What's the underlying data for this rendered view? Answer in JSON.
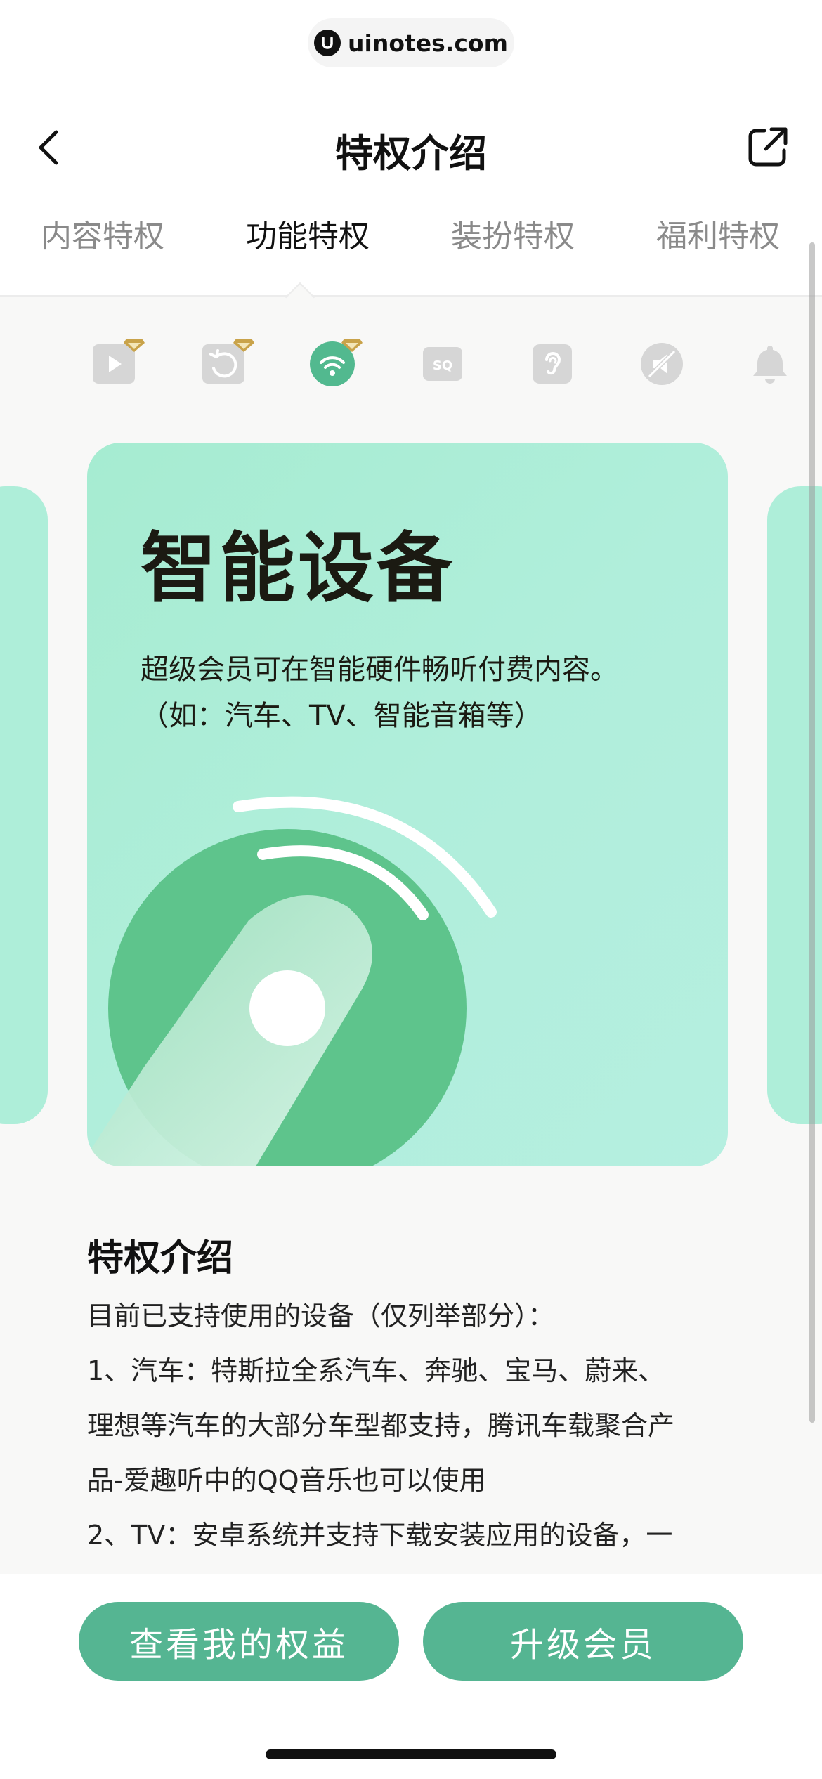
{
  "url_bar": {
    "domain": "uinotes.com"
  },
  "nav": {
    "title": "特权介绍"
  },
  "tabs": [
    {
      "label": "内容特权",
      "active": false
    },
    {
      "label": "功能特权",
      "active": true
    },
    {
      "label": "装扮特权",
      "active": false
    },
    {
      "label": "福利特权",
      "active": false
    }
  ],
  "privilege_icons": [
    {
      "name": "video-icon",
      "badge": true,
      "active": false
    },
    {
      "name": "replay-icon",
      "badge": true,
      "active": false
    },
    {
      "name": "smart-device-icon",
      "badge": true,
      "active": true
    },
    {
      "name": "sq-quality-icon",
      "badge": false,
      "active": false
    },
    {
      "name": "hearing-icon",
      "badge": false,
      "active": false
    },
    {
      "name": "no-ads-icon",
      "badge": false,
      "active": false
    },
    {
      "name": "bell-icon",
      "badge": false,
      "active": false
    }
  ],
  "card": {
    "title": "智能设备",
    "desc_line1": "超级会员可在智能硬件畅听付费内容。",
    "desc_line2": "（如：汽车、TV、智能音箱等）"
  },
  "section": {
    "title": "特权介绍",
    "line1": "目前已支持使用的设备（仅列举部分）：",
    "line2": "1、汽车：特斯拉全系汽车、奔驰、宝马、蔚来、",
    "line3": "理想等汽车的大部分车型都支持，腾讯车载聚合产",
    "line4": "品-爱趣听中的QQ音乐也可以使用",
    "line5": "2、TV：安卓系统并支持下载安装应用的设备，一"
  },
  "buttons": {
    "my_benefits": "查看我的权益",
    "upgrade": "升级会员"
  },
  "colors": {
    "accent": "#55b592",
    "card_bg": "#aeeed9",
    "icon_active": "#52b98f",
    "icon_inactive": "#d6d6d6",
    "badge": "#c9a34a"
  }
}
